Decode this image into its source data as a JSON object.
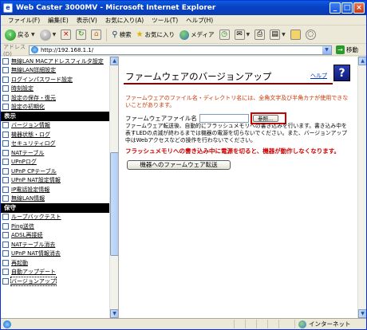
{
  "window": {
    "title": "Web Caster 3000MV - Microsoft Internet Explorer",
    "app_icon": "ie-icon"
  },
  "menubar": {
    "items": [
      "ファイル(F)",
      "編集(E)",
      "表示(V)",
      "お気に入り(A)",
      "ツール(T)",
      "ヘルプ(H)"
    ]
  },
  "toolbar": {
    "back_label": "戻る",
    "search_label": "検索",
    "favorites_label": "お気に入り",
    "media_label": "メディア"
  },
  "address": {
    "label": "アドレス(D)",
    "url": "http://192.168.1.1/",
    "go_label": "移動"
  },
  "sidebar": {
    "items_top": [
      "無線LAN MACアドレスフィルタ設定",
      "無線LAN詳細設定",
      "ログインパスワード設定",
      "時刻設定",
      "設定の保存・復元",
      "設定の初期化"
    ],
    "section_display": "表示",
    "items_display": [
      "バージョン情報",
      "機器状態・ログ",
      "セキュリティログ",
      "NATテーブル",
      "UPnPログ",
      "UPnP CPテーブル",
      "UPnP NAT設定情報",
      "IP電話設定情報",
      "無線LAN情報"
    ],
    "section_maint": "保守",
    "items_maint": [
      "ループバックテスト",
      "Ping送信",
      "ADSL再接続",
      "NATテーブル消去",
      "UPnP NAT情報消去",
      "再起動",
      "自動アップデート",
      "バージョンアップ"
    ]
  },
  "main": {
    "page_title": "ファームウェアのバージョンアップ",
    "help_link": "ヘルプ",
    "help_icon": "question-icon",
    "warning_chars": "ファームウェアのファイル名・ディレクトリ名には、全角文字及び半角カナが使用できないことがあります。",
    "file_label": "ファームウェアファイル名",
    "file_value": "",
    "browse_label": "参照...",
    "description": "ファームウェア転送後、自動的にフラッシュメモリへの書き込みを行います。書き込み中を表すLEDの点滅が終わるまでは機器の電源を切らないでください。また、バージョンアップ中はWebアクセスなどの操作を行わないでください。",
    "warning_flash": "フラッシュメモリへの書き込み中に電源を切ると、機器が動作しなくなります。",
    "transfer_button": "機器へのファームウェア転送"
  },
  "statusbar": {
    "zone": "インターネット"
  }
}
